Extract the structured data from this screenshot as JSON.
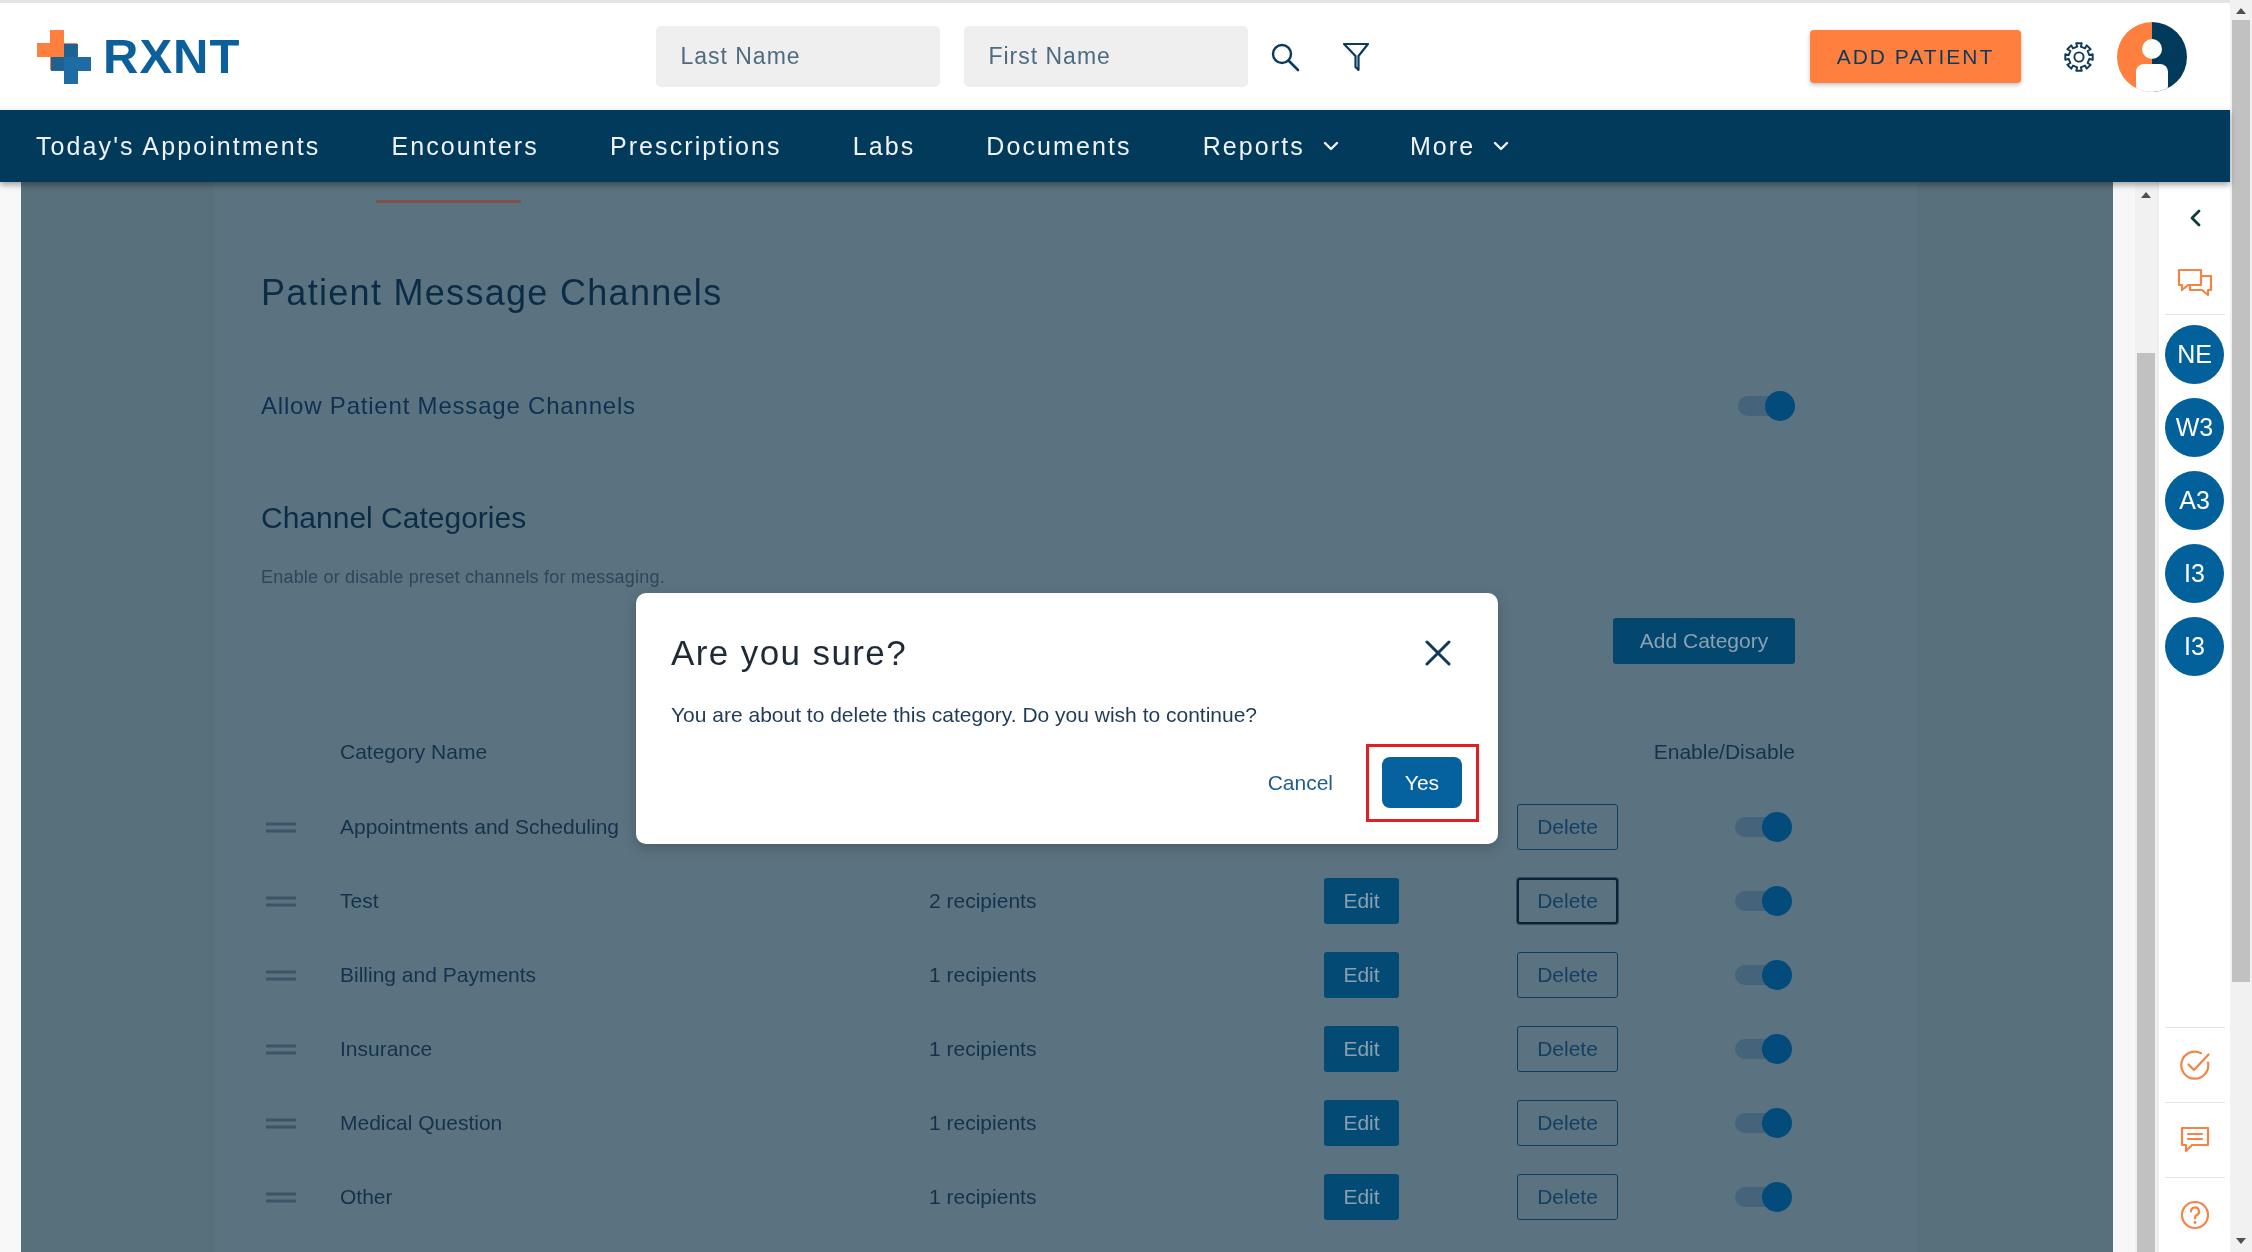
{
  "header": {
    "logo": {
      "text": "RXNT"
    },
    "search_fields": [
      {
        "placeholder": "Last Name"
      },
      {
        "placeholder": "First Name"
      }
    ],
    "add_patient_button": "ADD PATIENT"
  },
  "nav": [
    {
      "label": "Today's Appointments",
      "has_menu": false
    },
    {
      "label": "Encounters",
      "has_menu": false
    },
    {
      "label": "Prescriptions",
      "has_menu": false
    },
    {
      "label": "Labs",
      "has_menu": false
    },
    {
      "label": "Documents",
      "has_menu": false
    },
    {
      "label": "Reports",
      "has_menu": true
    },
    {
      "label": "More",
      "has_menu": true
    }
  ],
  "settings": {
    "title": "Patient Message Channels",
    "allow_channels": {
      "label": "Allow Patient Message Channels",
      "on": true
    },
    "categories": {
      "title": "Channel Categories",
      "hint": "Enable or disable preset channels for messaging.",
      "add_button": "Add Category",
      "columns": [
        "Category Name",
        "Enable/Disable"
      ],
      "rows": [
        {
          "name": "Appointments and Scheduling",
          "delete_button": "Delete",
          "focused": false,
          "on": true
        },
        {
          "name": "Test",
          "recipients": "2 recipients",
          "edit_button": "Edit",
          "delete_button": "Delete",
          "focused": true,
          "on": true
        },
        {
          "name": "Billing and Payments",
          "recipients": "1 recipients",
          "edit_button": "Edit",
          "delete_button": "Delete",
          "focused": false,
          "on": true
        },
        {
          "name": "Insurance",
          "recipients": "1 recipients",
          "edit_button": "Edit",
          "delete_button": "Delete",
          "focused": false,
          "on": true
        },
        {
          "name": "Medical Question",
          "recipients": "1 recipients",
          "edit_button": "Edit",
          "delete_button": "Delete",
          "focused": false,
          "on": true
        },
        {
          "name": "Other",
          "recipients": "1 recipients",
          "edit_button": "Edit",
          "delete_button": "Delete",
          "focused": false,
          "on": true
        }
      ]
    }
  },
  "dialog": {
    "title": "Are you sure?",
    "message": "You are about to delete this category. Do you wish to continue?",
    "cancel_button": "Cancel",
    "confirm_button": {
      "label": "Yes",
      "highlighted": true
    }
  },
  "right_panel": {
    "avatars": [
      {
        "initials": "NE"
      },
      {
        "initials": "W3"
      },
      {
        "initials": "A3"
      },
      {
        "initials": "I3"
      },
      {
        "initials": "I3"
      }
    ]
  }
}
